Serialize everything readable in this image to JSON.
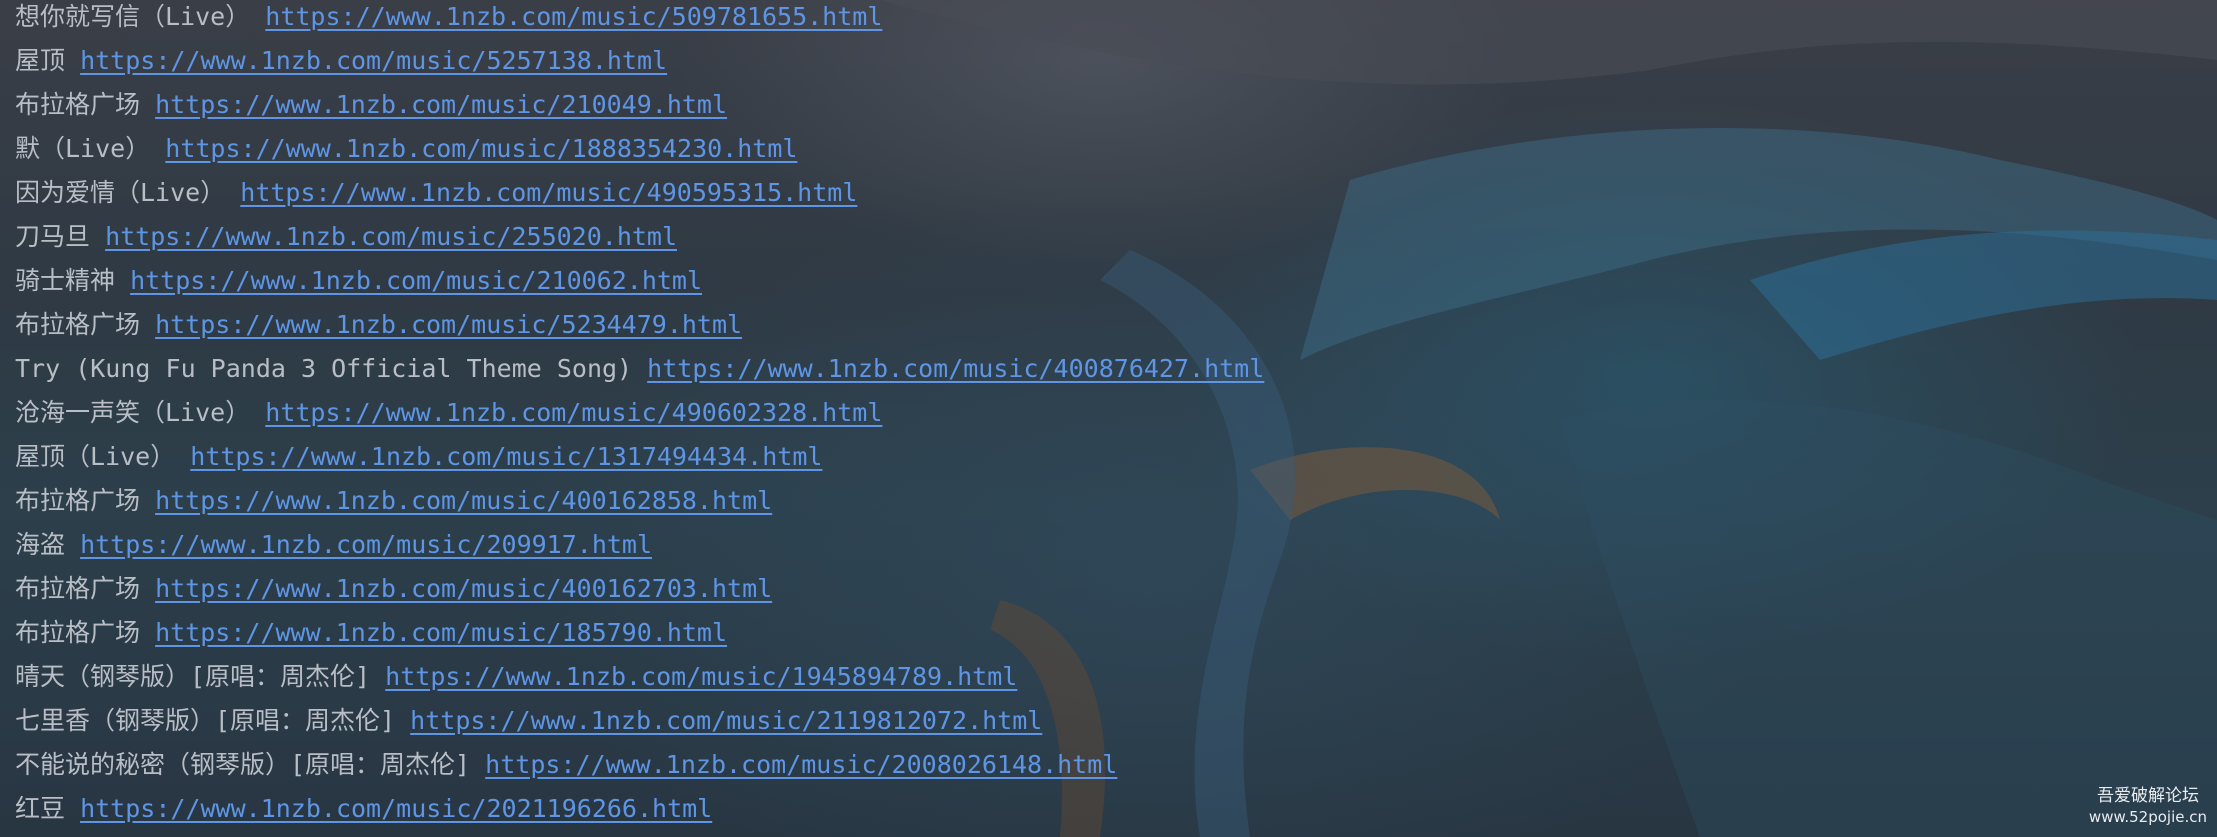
{
  "console": {
    "lines": [
      {
        "title": "想你就写信（Live）",
        "url": "https://www.1nzb.com/music/509781655.html"
      },
      {
        "title": "屋顶",
        "url": "https://www.1nzb.com/music/5257138.html"
      },
      {
        "title": "布拉格广场",
        "url": "https://www.1nzb.com/music/210049.html"
      },
      {
        "title": "默（Live）",
        "url": "https://www.1nzb.com/music/1888354230.html"
      },
      {
        "title": "因为爱情（Live）",
        "url": "https://www.1nzb.com/music/490595315.html"
      },
      {
        "title": "刀马旦",
        "url": "https://www.1nzb.com/music/255020.html"
      },
      {
        "title": "骑士精神",
        "url": "https://www.1nzb.com/music/210062.html"
      },
      {
        "title": "布拉格广场",
        "url": "https://www.1nzb.com/music/5234479.html"
      },
      {
        "title": "Try (Kung Fu Panda 3 Official Theme Song)",
        "url": "https://www.1nzb.com/music/400876427.html"
      },
      {
        "title": "沧海一声笑（Live）",
        "url": "https://www.1nzb.com/music/490602328.html"
      },
      {
        "title": "屋顶（Live）",
        "url": "https://www.1nzb.com/music/1317494434.html"
      },
      {
        "title": "布拉格广场",
        "url": "https://www.1nzb.com/music/400162858.html"
      },
      {
        "title": "海盗",
        "url": "https://www.1nzb.com/music/209917.html"
      },
      {
        "title": "布拉格广场",
        "url": "https://www.1nzb.com/music/400162703.html"
      },
      {
        "title": "布拉格广场",
        "url": "https://www.1nzb.com/music/185790.html"
      },
      {
        "title": "晴天（钢琴版）[原唱：周杰伦]",
        "url": "https://www.1nzb.com/music/1945894789.html"
      },
      {
        "title": "七里香（钢琴版）[原唱：周杰伦]",
        "url": "https://www.1nzb.com/music/2119812072.html"
      },
      {
        "title": "不能说的秘密（钢琴版）[原唱：周杰伦]",
        "url": "https://www.1nzb.com/music/2008026148.html"
      },
      {
        "title": "红豆",
        "url": "https://www.1nzb.com/music/2021196266.html"
      }
    ]
  },
  "watermark": {
    "site_name": "吾爱破解论坛",
    "site_url": "www.52pojie.cn"
  },
  "colors": {
    "text": "#b9bec6",
    "link": "#5e95e4",
    "background": "#2f3a44"
  }
}
